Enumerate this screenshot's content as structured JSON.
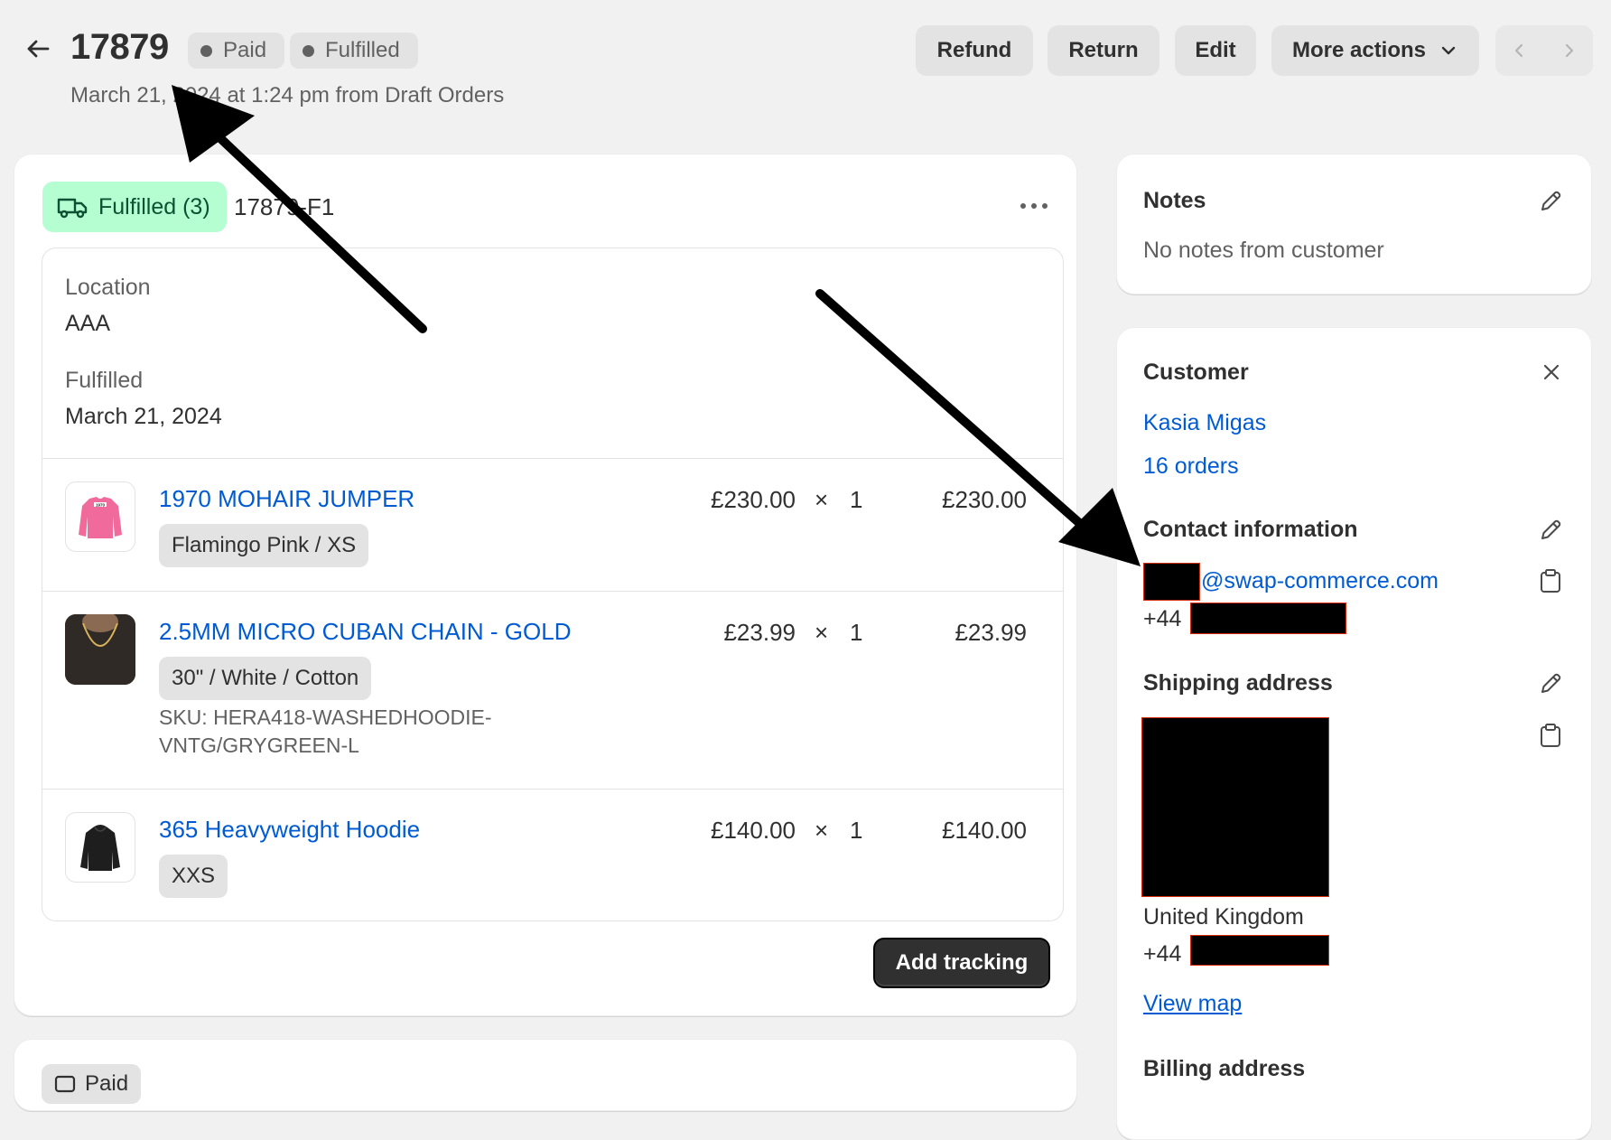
{
  "header": {
    "order_number": "17879",
    "badges": [
      {
        "label": "Paid"
      },
      {
        "label": "Fulfilled"
      }
    ],
    "subtitle": "March 21, 2024 at 1:24 pm from Draft Orders",
    "actions": {
      "refund": "Refund",
      "return": "Return",
      "edit": "Edit",
      "more_actions": "More actions"
    }
  },
  "fulfillment": {
    "status_label": "Fulfilled (3)",
    "fulfillment_id": "17879-F1",
    "location_label": "Location",
    "location_value": "AAA",
    "fulfilled_label": "Fulfilled",
    "fulfilled_value": "March 21, 2024",
    "items": [
      {
        "title": "1970 MOHAIR JUMPER",
        "variant": "Flamingo Pink / XS",
        "price": "£230.00",
        "times": "×",
        "quantity": "1",
        "total": "£230.00",
        "sku": ""
      },
      {
        "title": "2.5MM MICRO CUBAN CHAIN - GOLD",
        "variant": "30\" / White / Cotton",
        "price": "£23.99",
        "times": "×",
        "quantity": "1",
        "total": "£23.99",
        "sku_line1": "SKU: HERA418-WASHEDHOODIE-",
        "sku_line2": "VNTG/GRYGREEN-L"
      },
      {
        "title": "365 Heavyweight Hoodie",
        "variant": "XXS",
        "price": "£140.00",
        "times": "×",
        "quantity": "1",
        "total": "£140.00",
        "sku": ""
      }
    ],
    "add_tracking": "Add tracking",
    "thumb_text": "1970"
  },
  "next_card": {
    "badge_label": "Paid"
  },
  "notes": {
    "title": "Notes",
    "body": "No notes from customer"
  },
  "customer": {
    "title": "Customer",
    "name": "Kasia Migas",
    "orders": "16 orders",
    "contact_title": "Contact information",
    "email_domain": "@swap-commerce.com",
    "phone_prefix": "+44",
    "shipping_title": "Shipping address",
    "shipping_country": "United Kingdom",
    "shipping_phone_prefix": "+44",
    "view_map": "View map",
    "billing_title": "Billing address"
  },
  "colors": {
    "link": "#005bd3",
    "fulfilled_badge_bg": "#b4fed2",
    "primary_button": "#303030",
    "page_bg": "#f1f1f1"
  }
}
